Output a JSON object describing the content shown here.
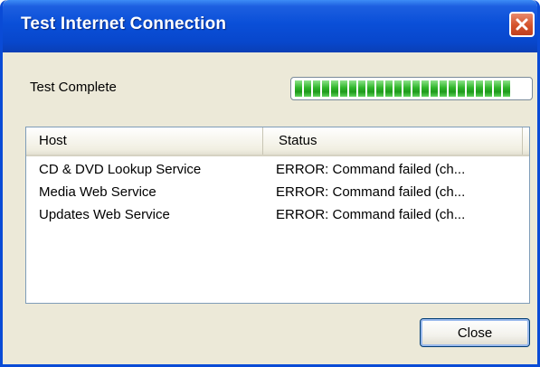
{
  "window": {
    "title": "Test Internet Connection"
  },
  "icons": {
    "close": "close-icon"
  },
  "progress": {
    "label": "Test Complete",
    "fraction": 1.0,
    "segments": 24
  },
  "list": {
    "columns": [
      "Host",
      "Status"
    ],
    "rows": [
      {
        "host": "CD & DVD Lookup Service",
        "status": "ERROR: Command failed (ch..."
      },
      {
        "host": "Media Web Service",
        "status": "ERROR: Command failed (ch..."
      },
      {
        "host": "Updates Web Service",
        "status": "ERROR: Command failed (ch..."
      }
    ]
  },
  "buttons": {
    "close_label": "Close"
  },
  "colors": {
    "titlebar": "#0a4fd8",
    "close_button": "#d4532b",
    "progress": "#2fb52a",
    "dialog_bg": "#ece9d8"
  }
}
